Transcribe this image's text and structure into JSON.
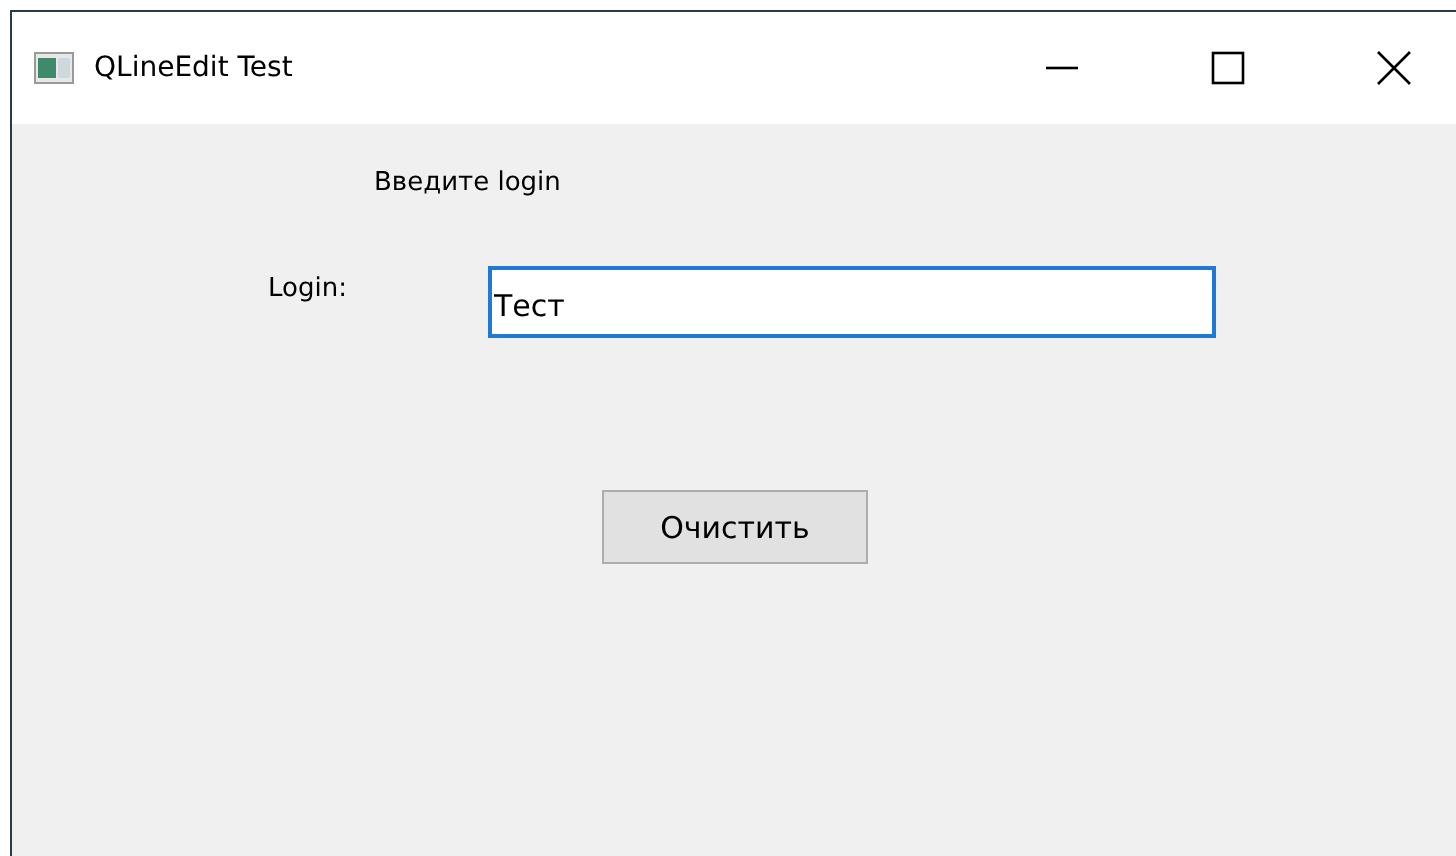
{
  "window": {
    "title": "QLineEdit Test"
  },
  "heading": "Введите login",
  "login_field": {
    "label": "Login:",
    "value": "Тест"
  },
  "buttons": [
    "Очистить"
  ]
}
